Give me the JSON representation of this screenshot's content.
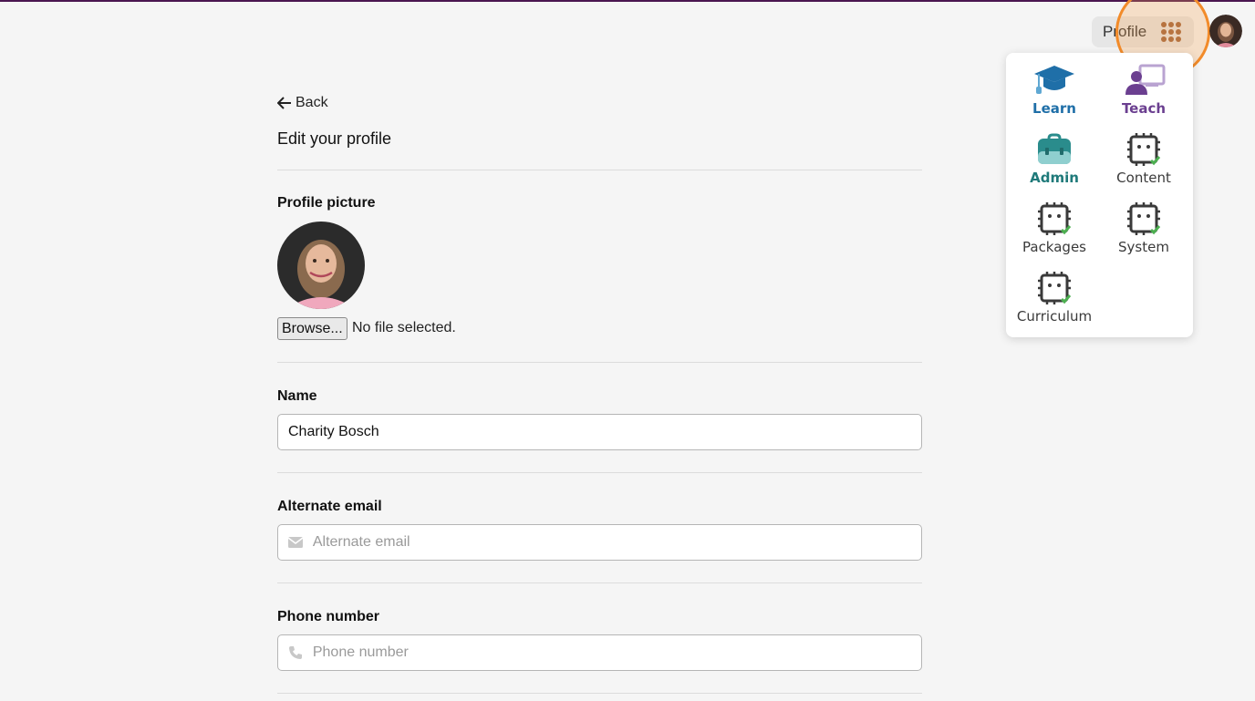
{
  "header": {
    "profile_label": "Profile",
    "apps_icon": "grid-dots-icon",
    "avatar_icon": "user-avatar"
  },
  "app_menu": {
    "items": [
      {
        "label": "Learn",
        "icon": "graduation-cap-icon",
        "color": "#1f6fa8"
      },
      {
        "label": "Teach",
        "icon": "teacher-board-icon",
        "color": "#6b3f90"
      },
      {
        "label": "Admin",
        "icon": "briefcase-icon",
        "color": "#1f7a7a"
      },
      {
        "label": "Content",
        "icon": "chip-check-icon",
        "color": "#3a3a3a"
      },
      {
        "label": "Packages",
        "icon": "chip-check-icon",
        "color": "#3a3a3a"
      },
      {
        "label": "System",
        "icon": "chip-check-icon",
        "color": "#3a3a3a"
      },
      {
        "label": "Curriculum",
        "icon": "chip-check-icon",
        "color": "#3a3a3a"
      }
    ]
  },
  "form": {
    "back_label": "Back",
    "title": "Edit your profile",
    "profile_picture_label": "Profile picture",
    "browse_label": "Browse...",
    "file_status": "No file selected.",
    "name_label": "Name",
    "name_value": "Charity Bosch",
    "alt_email_label": "Alternate email",
    "alt_email_placeholder": "Alternate email",
    "phone_label": "Phone number",
    "phone_placeholder": "Phone number"
  },
  "colors": {
    "accent_bar": "#4a1650",
    "highlight": "#f28b2a",
    "apps_icon": "#a0623a"
  }
}
